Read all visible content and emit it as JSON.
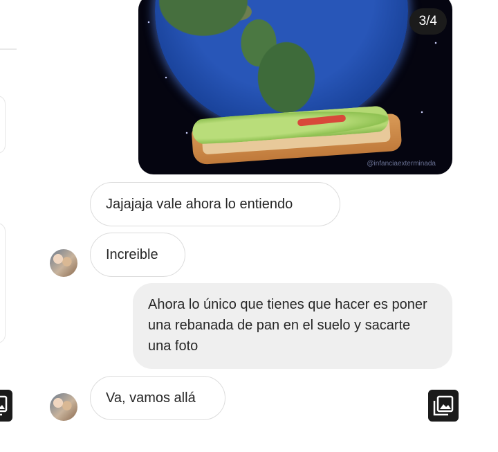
{
  "photo_viewer": {
    "counter": "3/4",
    "watermark": "@infanciaexterminada"
  },
  "messages": [
    {
      "side": "received",
      "text": "Jajajaja vale ahora lo entiendo",
      "show_avatar": false
    },
    {
      "side": "received",
      "text": "Increible",
      "show_avatar": true
    },
    {
      "side": "sent",
      "text": "Ahora lo único que tienes que hacer es poner una rebanada de pan en el suelo y sacarte una foto"
    },
    {
      "side": "received",
      "text": "Va, vamos allá",
      "show_avatar": true
    }
  ],
  "icons": {
    "gallery": "gallery-icon",
    "avatar": "avatar"
  },
  "colors": {
    "sent_bubble": "#efefef",
    "received_border": "#dcdcdc",
    "counter_bg": "#1b1b1b"
  }
}
